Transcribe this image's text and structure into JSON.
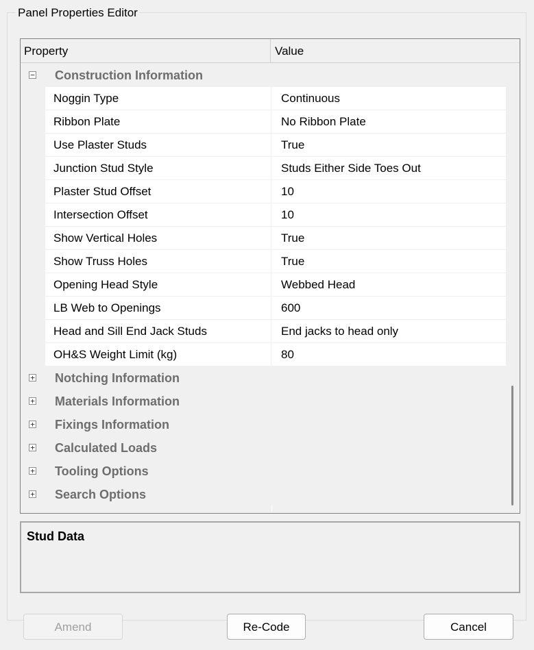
{
  "group_title": "Panel Properties Editor",
  "grid": {
    "header": {
      "property": "Property",
      "value": "Value"
    },
    "categories": [
      {
        "label": "Construction Information",
        "expanded": true,
        "toggle": "−",
        "items": [
          {
            "property": "Noggin Type",
            "value": "Continuous"
          },
          {
            "property": "Ribbon Plate",
            "value": "No Ribbon Plate"
          },
          {
            "property": "Use Plaster Studs",
            "value": "True"
          },
          {
            "property": "Junction Stud Style",
            "value": "Studs Either Side Toes Out"
          },
          {
            "property": "Plaster Stud Offset",
            "value": "10"
          },
          {
            "property": "Intersection Offset",
            "value": "10"
          },
          {
            "property": "Show Vertical Holes",
            "value": "True"
          },
          {
            "property": "Show Truss Holes",
            "value": "True"
          },
          {
            "property": "Opening Head Style",
            "value": "Webbed Head"
          },
          {
            "property": "LB Web to Openings",
            "value": "600"
          },
          {
            "property": "Head and Sill End Jack Studs",
            "value": "End jacks to head only"
          },
          {
            "property": "OH&S Weight Limit (kg)",
            "value": "80"
          }
        ]
      },
      {
        "label": "Notching Information",
        "expanded": false,
        "toggle": "+"
      },
      {
        "label": "Materials Information",
        "expanded": false,
        "toggle": "+"
      },
      {
        "label": "Fixings Information",
        "expanded": false,
        "toggle": "+"
      },
      {
        "label": "Calculated Loads",
        "expanded": false,
        "toggle": "+"
      },
      {
        "label": "Tooling Options",
        "expanded": false,
        "toggle": "+"
      },
      {
        "label": "Search Options",
        "expanded": false,
        "toggle": "+"
      }
    ]
  },
  "description": {
    "title": "Stud Data"
  },
  "buttons": {
    "amend": "Amend",
    "recode": "Re-Code",
    "cancel": "Cancel"
  }
}
